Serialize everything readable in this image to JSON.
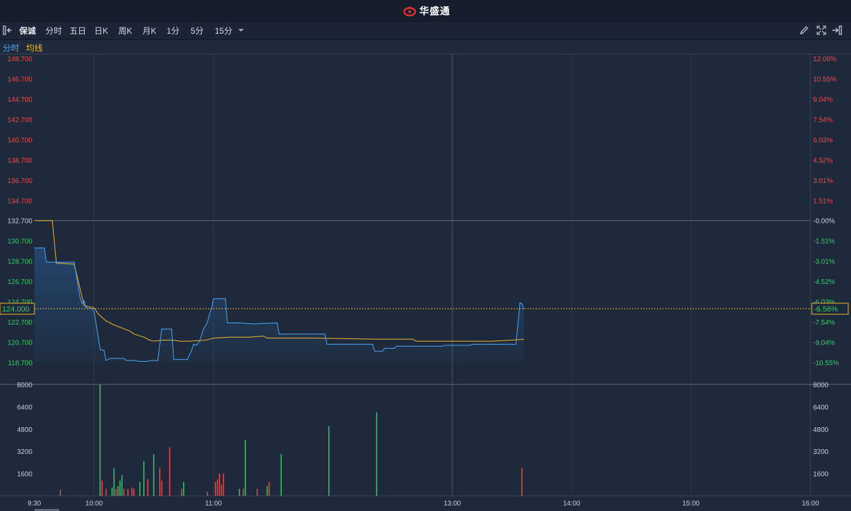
{
  "brand": {
    "name": "华盛通",
    "icon": "huasheng-logo-icon",
    "color": "#e8302e"
  },
  "toolbar": {
    "left_icon": "collapse-left-icon",
    "stock_name": "保诚",
    "tabs": [
      {
        "label": "分时",
        "active": true
      },
      {
        "label": "五日",
        "active": false
      },
      {
        "label": "日K",
        "active": false
      },
      {
        "label": "周K",
        "active": false
      },
      {
        "label": "月K",
        "active": false
      },
      {
        "label": "1分",
        "active": false
      },
      {
        "label": "5分",
        "active": false
      },
      {
        "label": "15分",
        "active": false
      }
    ],
    "dropdown_icon": "caret-down-icon",
    "right_icons": [
      "pencil-icon",
      "expand-icon",
      "exit-panel-icon"
    ]
  },
  "legend": {
    "minute_label": "分时",
    "avg_label": "均线",
    "minute_color": "#4aa8ff",
    "avg_color": "#f5b72a"
  },
  "price_readout": {
    "left": "124.000",
    "right": "-6.56%"
  },
  "colors": {
    "up": "#f04848",
    "down": "#33cc66",
    "flat": "#c8cfd8",
    "grid": "#2d3a4d"
  },
  "chart_data": {
    "type": "line",
    "prev_close": 132.7,
    "ylim": [
      118.7,
      148.7
    ],
    "price_ticks": [
      "148.700",
      "146.700",
      "144.700",
      "142.700",
      "140.700",
      "138.700",
      "136.700",
      "134.700",
      "132.700",
      "130.700",
      "128.700",
      "126.700",
      "124.700",
      "122.700",
      "120.700",
      "118.700"
    ],
    "pct_ticks": [
      "12.06%",
      "10.55%",
      "9.04%",
      "7.54%",
      "6.03%",
      "4.52%",
      "3.01%",
      "1.51%",
      "-0.00%",
      "-1.51%",
      "-3.01%",
      "-4.52%",
      "-6.03%",
      "-7.54%",
      "-9.04%",
      "-10.55%"
    ],
    "time_ticks": [
      "9:30",
      "10:00",
      "11:00",
      "13:00",
      "14:00",
      "15:00",
      "16:00"
    ],
    "time_tick_min": [
      0,
      30,
      90,
      210,
      270,
      330,
      390
    ],
    "current_price": 124.0,
    "series": [
      {
        "name": "分时",
        "points": [
          [
            0,
            130.0
          ],
          [
            5,
            130.0
          ],
          [
            6,
            128.6
          ],
          [
            20,
            128.6
          ],
          [
            23,
            125.0
          ],
          [
            24,
            124.5
          ],
          [
            25,
            124.8
          ],
          [
            26,
            124.1
          ],
          [
            29,
            124.0
          ],
          [
            30,
            123.7
          ],
          [
            31,
            122.5
          ],
          [
            33,
            120.0
          ],
          [
            34,
            119.9
          ],
          [
            35,
            119.9
          ],
          [
            36,
            118.9
          ],
          [
            38,
            119.1
          ],
          [
            45,
            119.1
          ],
          [
            46,
            118.9
          ],
          [
            50,
            118.9
          ],
          [
            53,
            118.8
          ],
          [
            57,
            118.8
          ],
          [
            58,
            118.9
          ],
          [
            62,
            118.9
          ],
          [
            63,
            120.5
          ],
          [
            64,
            122.0
          ],
          [
            69,
            122.0
          ],
          [
            70,
            119.0
          ],
          [
            77,
            119.0
          ],
          [
            78,
            119.5
          ],
          [
            79,
            119.9
          ],
          [
            80,
            120.5
          ],
          [
            81,
            120.4
          ],
          [
            82,
            120.5
          ],
          [
            83,
            120.8
          ],
          [
            85,
            122.0
          ],
          [
            87,
            122.7
          ],
          [
            88,
            123.5
          ],
          [
            89,
            124.0
          ],
          [
            90,
            125.0
          ],
          [
            96,
            125.0
          ],
          [
            97,
            122.6
          ],
          [
            103,
            122.6
          ],
          [
            110,
            122.5
          ],
          [
            122,
            122.6
          ],
          [
            123,
            121.5
          ],
          [
            146,
            121.5
          ],
          [
            147,
            120.5
          ],
          [
            170,
            120.5
          ],
          [
            171,
            119.8
          ],
          [
            175,
            119.8
          ],
          [
            176,
            120.1
          ],
          [
            181,
            120.1
          ],
          [
            182,
            120.3
          ],
          [
            205,
            120.3
          ],
          [
            206,
            120.4
          ],
          [
            219,
            120.4
          ],
          [
            220,
            120.5
          ],
          [
            242,
            120.5
          ],
          [
            243,
            122.5
          ],
          [
            244,
            124.6
          ],
          [
            245,
            124.5
          ],
          [
            246,
            124.0
          ]
        ]
      },
      {
        "name": "均线",
        "points": [
          [
            0,
            132.7
          ],
          [
            9,
            132.7
          ],
          [
            11,
            128.5
          ],
          [
            20,
            128.4
          ],
          [
            25,
            124.3
          ],
          [
            30,
            124.1
          ],
          [
            32,
            123.5
          ],
          [
            36,
            122.8
          ],
          [
            40,
            122.4
          ],
          [
            48,
            121.8
          ],
          [
            50,
            121.5
          ],
          [
            55,
            121.2
          ],
          [
            58,
            120.9
          ],
          [
            60,
            120.8
          ],
          [
            64,
            120.9
          ],
          [
            70,
            120.9
          ],
          [
            73,
            120.8
          ],
          [
            78,
            120.8
          ],
          [
            86,
            120.9
          ],
          [
            90,
            121.1
          ],
          [
            98,
            121.2
          ],
          [
            108,
            121.2
          ],
          [
            115,
            121.3
          ],
          [
            117,
            121.1
          ],
          [
            140,
            121.1
          ],
          [
            170,
            121.0
          ],
          [
            190,
            121.0
          ],
          [
            192,
            120.8
          ],
          [
            230,
            120.8
          ],
          [
            240,
            120.9
          ],
          [
            246,
            121.0
          ]
        ]
      }
    ],
    "volume": {
      "ylim": [
        0,
        8000
      ],
      "ticks": [
        "8000",
        "6400",
        "4800",
        "3200",
        "1600"
      ],
      "bars": [
        {
          "t": 13,
          "v": 450,
          "c": "up"
        },
        {
          "t": 33,
          "v": 8000,
          "c": "down"
        },
        {
          "t": 34,
          "v": 1100,
          "c": "up"
        },
        {
          "t": 36,
          "v": 500,
          "c": "up"
        },
        {
          "t": 39,
          "v": 600,
          "c": "down"
        },
        {
          "t": 40,
          "v": 2000,
          "c": "down"
        },
        {
          "t": 41,
          "v": 500,
          "c": "up"
        },
        {
          "t": 42,
          "v": 700,
          "c": "down"
        },
        {
          "t": 43,
          "v": 1100,
          "c": "down"
        },
        {
          "t": 44,
          "v": 1500,
          "c": "down"
        },
        {
          "t": 45,
          "v": 500,
          "c": "up"
        },
        {
          "t": 47,
          "v": 500,
          "c": "up"
        },
        {
          "t": 49,
          "v": 600,
          "c": "up"
        },
        {
          "t": 50,
          "v": 500,
          "c": "up"
        },
        {
          "t": 53,
          "v": 1000,
          "c": "down"
        },
        {
          "t": 55,
          "v": 2500,
          "c": "down"
        },
        {
          "t": 57,
          "v": 1200,
          "c": "up"
        },
        {
          "t": 60,
          "v": 3000,
          "c": "down"
        },
        {
          "t": 63,
          "v": 2000,
          "c": "up"
        },
        {
          "t": 64,
          "v": 1100,
          "c": "up"
        },
        {
          "t": 68,
          "v": 3500,
          "c": "up"
        },
        {
          "t": 74,
          "v": 500,
          "c": "up"
        },
        {
          "t": 75,
          "v": 1000,
          "c": "down"
        },
        {
          "t": 87,
          "v": 300,
          "c": "up"
        },
        {
          "t": 91,
          "v": 1000,
          "c": "up"
        },
        {
          "t": 92,
          "v": 1200,
          "c": "up"
        },
        {
          "t": 93,
          "v": 1600,
          "c": "up"
        },
        {
          "t": 94,
          "v": 800,
          "c": "up"
        },
        {
          "t": 95,
          "v": 1600,
          "c": "up"
        },
        {
          "t": 103,
          "v": 500,
          "c": "down"
        },
        {
          "t": 105,
          "v": 500,
          "c": "up"
        },
        {
          "t": 106,
          "v": 4000,
          "c": "down"
        },
        {
          "t": 112,
          "v": 500,
          "c": "up"
        },
        {
          "t": 117,
          "v": 700,
          "c": "down"
        },
        {
          "t": 118,
          "v": 1000,
          "c": "up"
        },
        {
          "t": 124,
          "v": 3000,
          "c": "down"
        },
        {
          "t": 148,
          "v": 5000,
          "c": "down"
        },
        {
          "t": 172,
          "v": 6000,
          "c": "down"
        },
        {
          "t": 245,
          "v": 2000,
          "c": "up"
        }
      ]
    }
  }
}
